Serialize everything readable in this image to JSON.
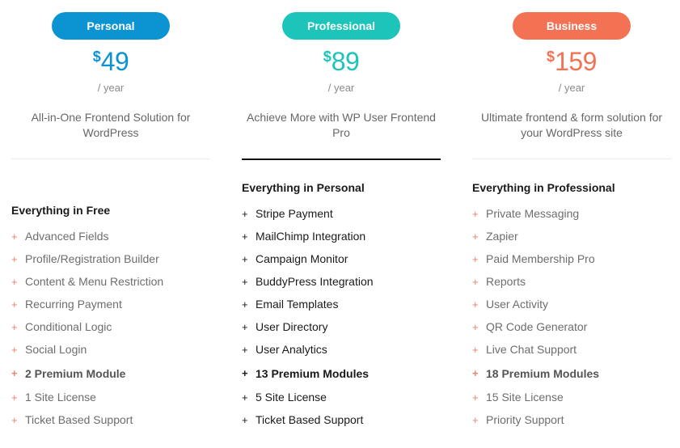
{
  "plans": [
    {
      "name": "Personal",
      "color": "#0c94d2",
      "currency": "$",
      "price": "49",
      "period": "/ year",
      "description": "All-in-One Frontend Solution for WordPress",
      "features_title": "Everything in Free",
      "features": [
        {
          "label": "Advanced Fields",
          "bold": false
        },
        {
          "label": "Profile/Registration Builder",
          "bold": false
        },
        {
          "label": "Content & Menu Restriction",
          "bold": false
        },
        {
          "label": "Recurring Payment",
          "bold": false
        },
        {
          "label": "Conditional Logic",
          "bold": false
        },
        {
          "label": "Social Login",
          "bold": false
        },
        {
          "label": "2 Premium Module",
          "bold": true
        },
        {
          "label": "1 Site License",
          "bold": false
        },
        {
          "label": "Ticket Based Support",
          "bold": false
        }
      ]
    },
    {
      "name": "Professional",
      "color": "#1cc4ba",
      "currency": "$",
      "price": "89",
      "period": "/ year",
      "description": "Achieve More with WP User Frontend Pro",
      "features_title": "Everything in Personal",
      "features": [
        {
          "label": "Stripe Payment",
          "bold": false
        },
        {
          "label": "MailChimp Integration",
          "bold": false
        },
        {
          "label": "Campaign Monitor",
          "bold": false
        },
        {
          "label": "BuddyPress Integration",
          "bold": false
        },
        {
          "label": "Email Templates",
          "bold": false
        },
        {
          "label": "User Directory",
          "bold": false
        },
        {
          "label": "User Analytics",
          "bold": false
        },
        {
          "label": "13 Premium Modules",
          "bold": true
        },
        {
          "label": "5 Site License",
          "bold": false
        },
        {
          "label": "Ticket Based Support",
          "bold": false
        }
      ]
    },
    {
      "name": "Business",
      "color": "#f47254",
      "currency": "$",
      "price": "159",
      "period": "/ year",
      "description": "Ultimate frontend & form solution for your WordPress site",
      "features_title": "Everything in Professional",
      "features": [
        {
          "label": "Private Messaging",
          "bold": false
        },
        {
          "label": "Zapier",
          "bold": false
        },
        {
          "label": "Paid Membership Pro",
          "bold": false
        },
        {
          "label": "Reports",
          "bold": false
        },
        {
          "label": "User Activity",
          "bold": false
        },
        {
          "label": "QR Code Generator",
          "bold": false
        },
        {
          "label": "Live Chat Support",
          "bold": false
        },
        {
          "label": "18 Premium Modules",
          "bold": true
        },
        {
          "label": "15 Site License",
          "bold": false
        },
        {
          "label": "Priority Support",
          "bold": false
        }
      ]
    }
  ],
  "plus_symbol": "+"
}
